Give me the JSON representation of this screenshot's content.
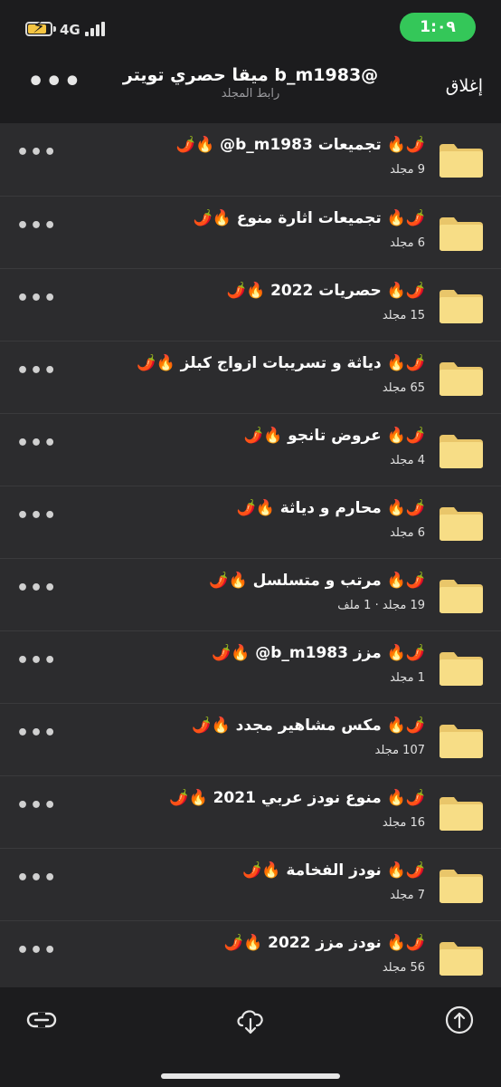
{
  "status_bar": {
    "network": "4G",
    "time": "1:٠٩",
    "accent": "#34c759"
  },
  "nav": {
    "title": "ميقا حصري تويتر b_m1983@",
    "subtitle": "رابط المجلد",
    "close_label": "إغلاق",
    "more_icon": "ellipsis-icon"
  },
  "folders": [
    {
      "name": "🌶️🔥 تجميعات b_m1983@ 🔥🌶️",
      "count": "9 مجلد"
    },
    {
      "name": "🌶️🔥 تجميعات اثارة منوع 🔥🌶️",
      "count": "6 مجلد"
    },
    {
      "name": "🌶️🔥 حصريات 2022 🔥🌶️",
      "count": "15 مجلد"
    },
    {
      "name": "🌶️🔥 دياثة و تسريبات ازواج كبلز 🔥🌶️",
      "count": "65 مجلد"
    },
    {
      "name": "🌶️🔥 عروض تانجو 🔥🌶️",
      "count": "4 مجلد"
    },
    {
      "name": "🌶️🔥 محارم و دياثة 🔥🌶️",
      "count": "6 مجلد"
    },
    {
      "name": "🌶️🔥 مرتب و متسلسل 🔥🌶️",
      "count": "19 مجلد · 1 ملف"
    },
    {
      "name": "🌶️🔥 مزز b_m1983@ 🔥🌶️",
      "count": "1 مجلد"
    },
    {
      "name": "🌶️🔥 مكس مشاهير مجدد 🔥🌶️",
      "count": "107 مجلد"
    },
    {
      "name": "🌶️🔥 منوع نودز عربي 2021 🔥🌶️",
      "count": "16 مجلد"
    },
    {
      "name": "🌶️🔥 نودز الفخامة 🔥🌶️",
      "count": "7 مجلد"
    },
    {
      "name": "🌶️🔥 نودز مزز 2022 🔥🌶️",
      "count": "56 مجلد"
    }
  ],
  "toolbar": {
    "left_icon": "link-icon",
    "center_icon": "cloud-download-icon",
    "right_icon": "upload-icon"
  },
  "colors": {
    "background": "#2c2c2e",
    "bar": "#1c1c1e",
    "folder": "#f7dd86"
  }
}
